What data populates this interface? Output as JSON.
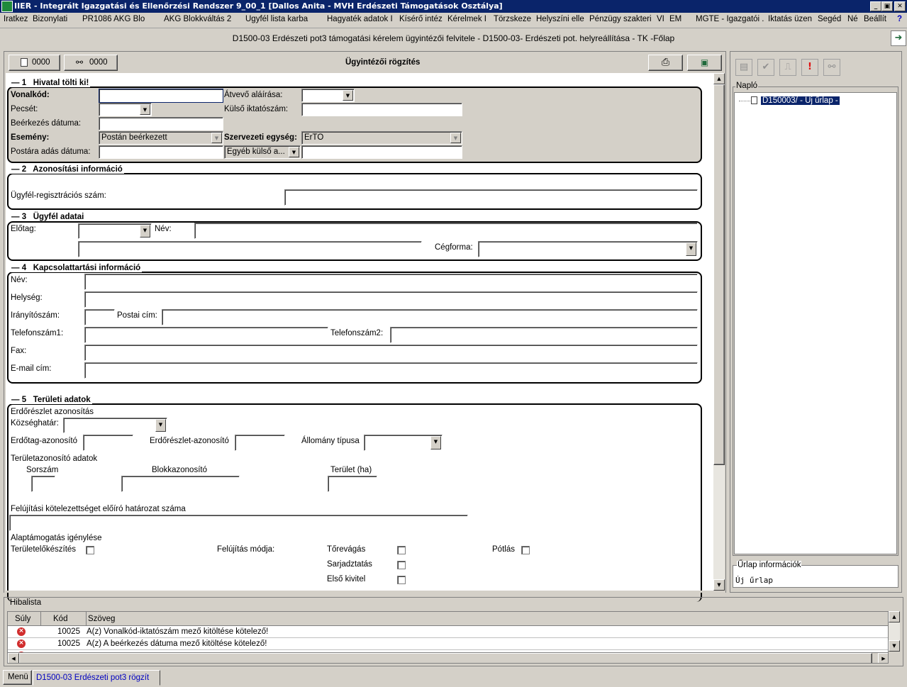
{
  "window": {
    "title": "IIER - Integrált Igazgatási és Ellenőrzési Rendszer 9_00_1 [Dallos Anita - MVH Erdészeti Támogatások Osztálya]",
    "min": "_",
    "max": "▣",
    "close": "✕"
  },
  "menu": [
    "Iratkez",
    "Bizonylati",
    "PR1086 AKG Blo",
    "AKG Blokkváltás 2",
    "Ügyfél lista karba",
    "Hagyaték adatok I",
    "Kísérő intéz",
    "Kérelmek I",
    "Törzskeze",
    "Helyszíni elle",
    "Pénzügy szakteri",
    "VI",
    "EM",
    "MGTE - Igazgatói .",
    "Iktatás üzen",
    "Segéd",
    "Né",
    "Beállít",
    "?"
  ],
  "subtitle": "D1500-03 Erdészeti pot3 támogatási kérelem ügyintézői felvitele - D1500-03- Erdészeti pot. helyreállítása - TK -Főlap",
  "form": {
    "tab1": "0000",
    "tab2": "0000",
    "title": "Ügyintézői rögzítés",
    "s1": {
      "num": "1",
      "title": "Hivatal tölti ki!",
      "vonalkod": "Vonalkód:",
      "atvevo": "Átvevő aláírása:",
      "pecset": "Pecsét:",
      "kulso": "Külső iktatószám:",
      "beerkezes": "Beérkezés dátuma:",
      "esemeny": "Esemény:",
      "esemeny_val": "Postán beérkezett",
      "szerv": "Szervezeti egység:",
      "szerv_val": "ErTO",
      "postara": "Postára adás dátuma:",
      "egyeb": "Egyéb külső a..."
    },
    "s2": {
      "num": "2",
      "title": "Azonosítási információ",
      "reg": "Ügyfél-regisztrációs szám:"
    },
    "s3": {
      "num": "3",
      "title": "Ügyfél adatai",
      "elotag": "Előtag:",
      "nev": "Név:",
      "cegforma": "Cégforma:"
    },
    "s4": {
      "num": "4",
      "title": "Kapcsolattartási információ",
      "nev": "Név:",
      "helyseg": "Helység:",
      "irsz": "Irányítószám:",
      "postai": "Postai cím:",
      "tel1": "Telefonszám1:",
      "tel2": "Telefonszám2:",
      "fax": "Fax:",
      "email": "E-mail cím:"
    },
    "s5": {
      "num": "5",
      "title": "Területi adatok",
      "erdoreszlet": "Erdőrészlet azonosítás",
      "kozseg": "Községhatár:",
      "erdotag": "Erdőtag-azonosító",
      "erdoreszlet_az": "Erdőrészlet-azonosító",
      "allomany": "Állomány típusa",
      "teruletaz": "Területazonosító adatok",
      "sorszam": "Sorszám",
      "blokk": "Blokkazonosító",
      "terulet": "Terület (ha)",
      "felujitasi": "Felújítási kötelezettséget előíró határozat száma",
      "alap": "Alaptámogatás igénylése",
      "teruletelo": "Területelőkészítés",
      "modja": "Felújítás módja:",
      "torevagas": "Tőrevágás",
      "sarjadztatas": "Sarjadztatás",
      "elso": "Első kivitel",
      "potlas": "Pótlás"
    }
  },
  "right": {
    "naplo": "Napló",
    "tree_item": "D150003/ - Új űrlap -",
    "info_title": "Űrlap információk",
    "info_text": "Új űrlap"
  },
  "errors": {
    "title": "Hibalista",
    "col_suly": "Súly",
    "col_kod": "Kód",
    "col_szoveg": "Szöveg",
    "rows": [
      {
        "kod": "10025",
        "text": "A(z) Vonalkód-iktatószám mező kitöltése kötelező!"
      },
      {
        "kod": "10025",
        "text": "A(z) A beérkezés dátuma mező kitöltése kötelező!"
      }
    ]
  },
  "taskbar": {
    "menu": "Menü",
    "active": "D1500-03 Erdészeti pot3 rögzít"
  }
}
